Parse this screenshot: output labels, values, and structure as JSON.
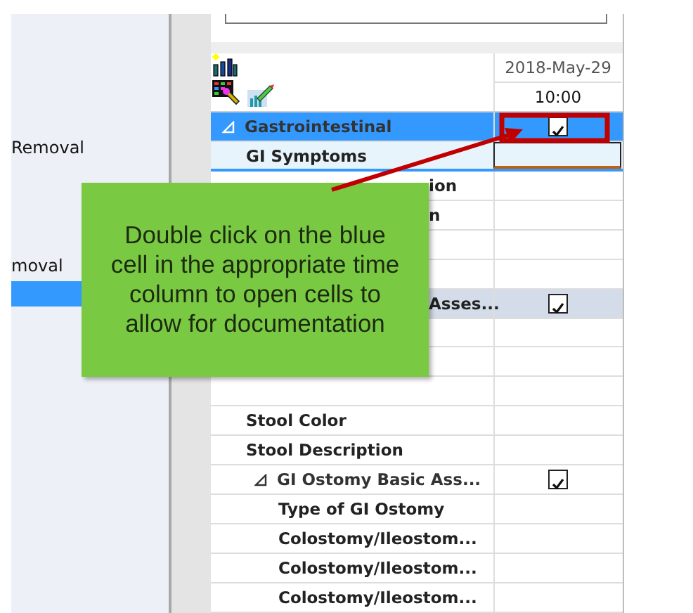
{
  "sidebar": {
    "items": [
      {
        "label": "Removal",
        "selected": false
      },
      {
        "label": "moval",
        "selected": false
      },
      {
        "selected": true
      }
    ]
  },
  "grid": {
    "column": {
      "date": "2018-May-29",
      "time": "10:00"
    },
    "rows": [
      {
        "kind": "section",
        "label": "Gastrointestinal",
        "selected": true,
        "checked": true
      },
      {
        "kind": "item",
        "label": "GI Symptoms",
        "focused": true
      },
      {
        "kind": "covered",
        "label": "ion"
      },
      {
        "kind": "covered",
        "label": "n"
      },
      {
        "kind": "covered"
      },
      {
        "kind": "covered"
      },
      {
        "kind": "covered-section",
        "label": "Asses...",
        "checked": true
      },
      {
        "kind": "covered"
      },
      {
        "kind": "covered"
      },
      {
        "kind": "covered"
      },
      {
        "kind": "item",
        "label": "Stool Color"
      },
      {
        "kind": "item",
        "label": "Stool Description"
      },
      {
        "kind": "subsection",
        "label": "GI Ostomy Basic Ass...",
        "checked": true
      },
      {
        "kind": "subitem",
        "label": "Type of GI Ostomy"
      },
      {
        "kind": "subitem",
        "label": "Colostomy/Ileostom..."
      },
      {
        "kind": "subitem",
        "label": "Colostomy/Ileostom..."
      },
      {
        "kind": "subitem",
        "label": "Colostomy/Ileostom..."
      }
    ]
  },
  "callout": {
    "text": "Double click on the blue cell in the appropriate time column to open cells to allow for documentation"
  }
}
